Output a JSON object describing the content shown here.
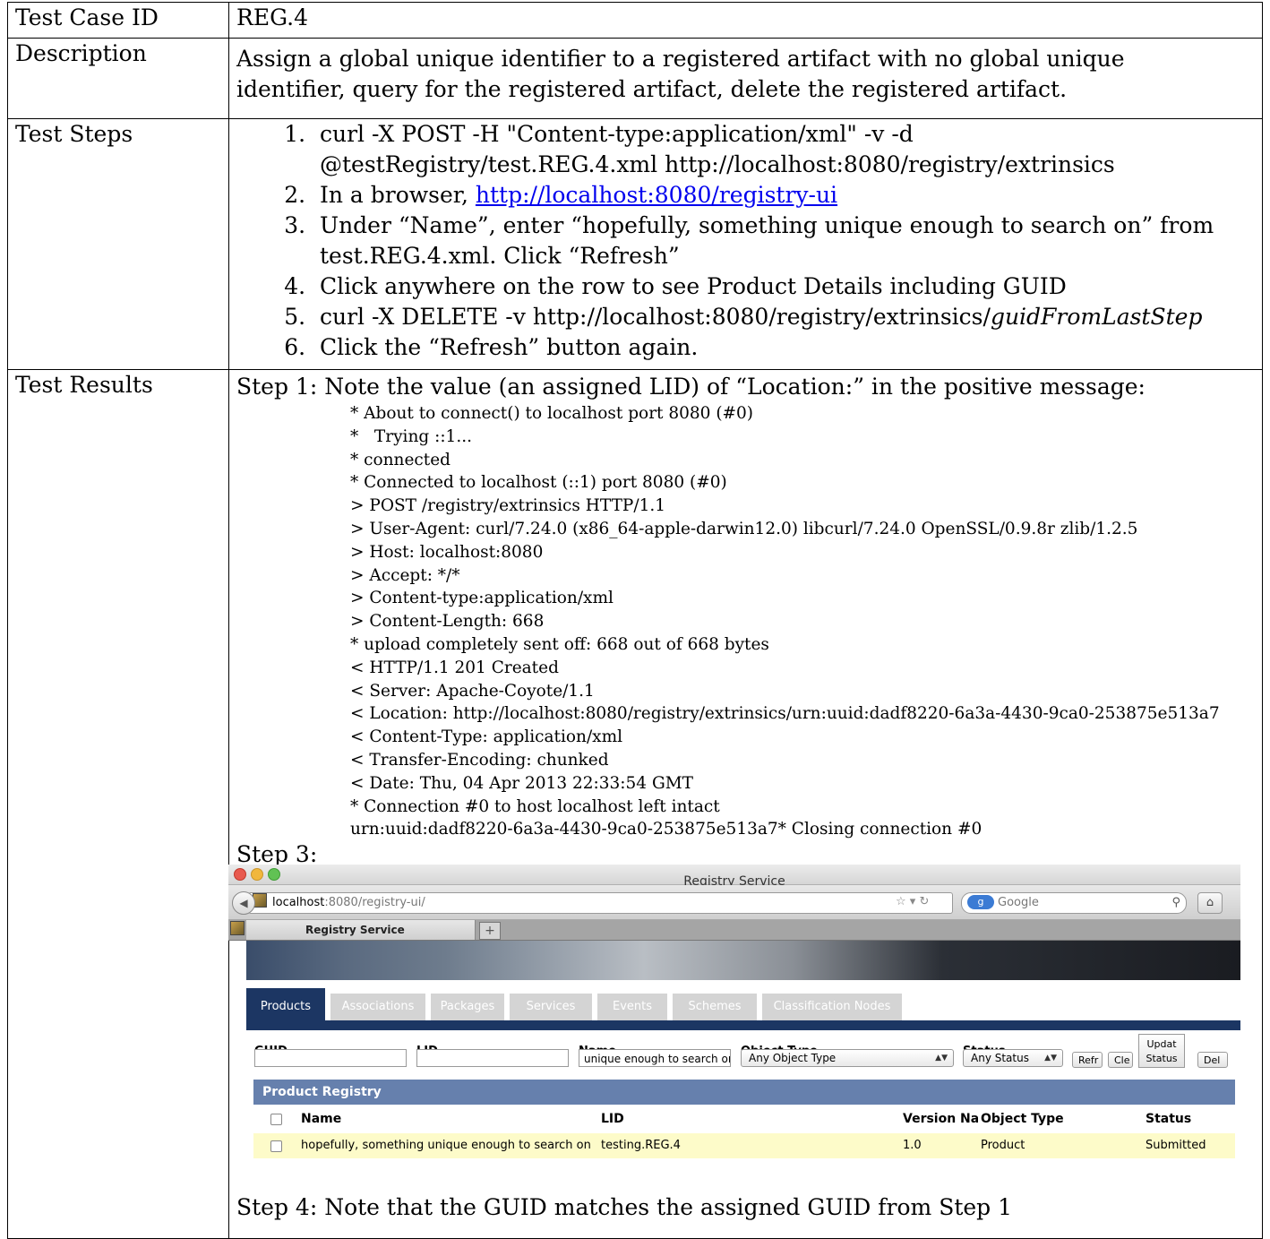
{
  "rows": {
    "id_label": "Test Case ID",
    "id_value": "REG.4",
    "desc_label": "Description",
    "desc_value": "Assign a global unique identifier to a registered artifact with no global unique identifier, query for the registered artifact, delete the registered artifact.",
    "steps_label": "Test Steps",
    "results_label": "Test Results"
  },
  "steps": {
    "s1": "curl -X POST -H \"Content-type:application/xml\" -v -d @testRegistry/test.REG.4.xml http://localhost:8080/registry/extrinsics",
    "s2_prefix": "In a browser, ",
    "s2_link": "http://localhost:8080/registry-ui",
    "s3": "Under “Name”, enter “hopefully, something unique enough to search on” from test.REG.4.xml. Click “Refresh”",
    "s4": "Click anywhere on the row to see Product Details including GUID",
    "s5_prefix": "curl -X DELETE -v http://localhost:8080/registry/extrinsics/",
    "s5_italic": "guidFromLastStep",
    "s6": "Click the “Refresh” button again."
  },
  "results": {
    "step1_note": "Step 1: Note the value (an assigned LID) of “Location:” in the positive message:",
    "log": [
      "* About to connect() to localhost port 8080 (#0)",
      "*   Trying ::1...",
      "* connected",
      "* Connected to localhost (::1) port 8080 (#0)",
      "> POST /registry/extrinsics HTTP/1.1",
      "> User-Agent: curl/7.24.0 (x86_64-apple-darwin12.0) libcurl/7.24.0 OpenSSL/0.9.8r zlib/1.2.5",
      "> Host: localhost:8080",
      "> Accept: */*",
      "> Content-type:application/xml",
      "> Content-Length: 668",
      "* upload completely sent off: 668 out of 668 bytes",
      "< HTTP/1.1 201 Created",
      "< Server: Apache-Coyote/1.1",
      "< Location: http://localhost:8080/registry/extrinsics/urn:uuid:dadf8220-6a3a-4430-9ca0-253875e513a7",
      "< Content-Type: application/xml",
      "< Transfer-Encoding: chunked",
      "< Date: Thu, 04 Apr 2013 22:33:54 GMT",
      "* Connection #0 to host localhost left intact",
      "urn:uuid:dadf8220-6a3a-4430-9ca0-253875e513a7* Closing connection #0"
    ],
    "step3_label": "Step 3:",
    "step4_note": "Step 4: Note that the GUID matches the assigned GUID from Step 1"
  },
  "browser": {
    "window_title": "Registry Service",
    "url_host": "localhost",
    "url_rest": ":8080/registry-ui/",
    "search_placeholder": "Google",
    "tab_title": "Registry Service",
    "app_tabs": [
      "Products",
      "Associations",
      "Packages",
      "Services",
      "Events",
      "Schemes",
      "Classification Nodes"
    ],
    "filters": {
      "guid_label": "GUID",
      "lid_label": "LID",
      "name_label": "Name",
      "name_value": "unique enough to search on",
      "objtype_label": "Object Type",
      "objtype_value": "Any Object Type",
      "status_label": "Status",
      "status_value": "Any Status",
      "refresh_btn": "Refr",
      "clear_btn": "Cle",
      "update_btn_line1": "Updat",
      "update_btn_line2": "Status",
      "delete_btn": "Del"
    },
    "registry": {
      "title": "Product Registry",
      "columns": [
        "Name",
        "LID",
        "Version Nar",
        "Object Type",
        "Status"
      ],
      "row": [
        "hopefully, something unique enough to search on",
        "testing.REG.4",
        "1.0",
        "Product",
        "Submitted"
      ]
    }
  }
}
